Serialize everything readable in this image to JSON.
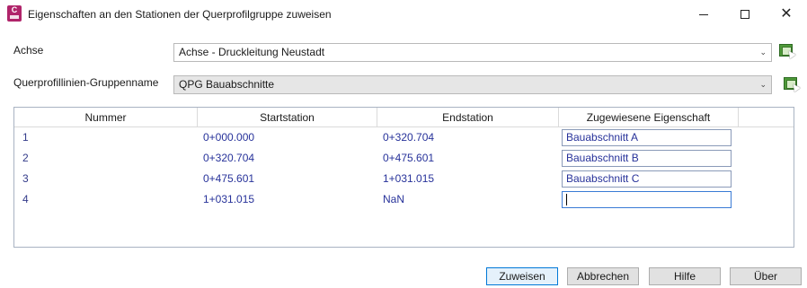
{
  "window": {
    "title": "Eigenschaften an den Stationen der Querprofilgruppe zuweisen",
    "app_icon_letter": "C"
  },
  "form": {
    "achse_label": "Achse",
    "achse_value": "Achse - Druckleitung Neustadt",
    "gruppe_label": "Querprofillinien-Gruppenname",
    "gruppe_value": "QPG Bauabschnitte"
  },
  "table": {
    "headers": [
      "Nummer",
      "Startstation",
      "Endstation",
      "Zugewiesene Eigenschaft"
    ],
    "rows": [
      {
        "nummer": "1",
        "start": "0+000.000",
        "end": "0+320.704",
        "eigenschaft": "Bauabschnitt A"
      },
      {
        "nummer": "2",
        "start": "0+320.704",
        "end": "0+475.601",
        "eigenschaft": "Bauabschnitt B"
      },
      {
        "nummer": "3",
        "start": "0+475.601",
        "end": "1+031.015",
        "eigenschaft": "Bauabschnitt C"
      },
      {
        "nummer": "4",
        "start": "1+031.015",
        "end": "NaN",
        "eigenschaft": ""
      }
    ]
  },
  "buttons": {
    "zuweisen": "Zuweisen",
    "abbrechen": "Abbrechen",
    "hilfe": "Hilfe",
    "ueber": "Über"
  },
  "colors": {
    "accent": "#0078d7",
    "cell_text": "#27329a",
    "app_icon": "#b0246a"
  }
}
